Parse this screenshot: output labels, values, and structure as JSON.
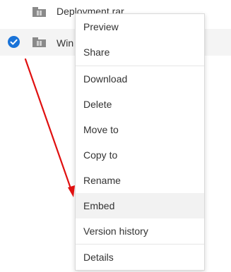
{
  "files": [
    {
      "name": "Deployment.rar",
      "selected": false,
      "icon": "archive-icon"
    },
    {
      "name": "Win",
      "selected": true,
      "icon": "archive-icon"
    }
  ],
  "context_menu": {
    "items": [
      "Preview",
      "Share",
      "Download",
      "Delete",
      "Move to",
      "Copy to",
      "Rename",
      "Embed",
      "Version history",
      "Details"
    ],
    "highlighted": "Embed"
  },
  "annotation": {
    "type": "arrow",
    "color": "#e01010"
  },
  "colors": {
    "accent": "#1a73d8",
    "menu_hover": "#f2f2f2"
  }
}
